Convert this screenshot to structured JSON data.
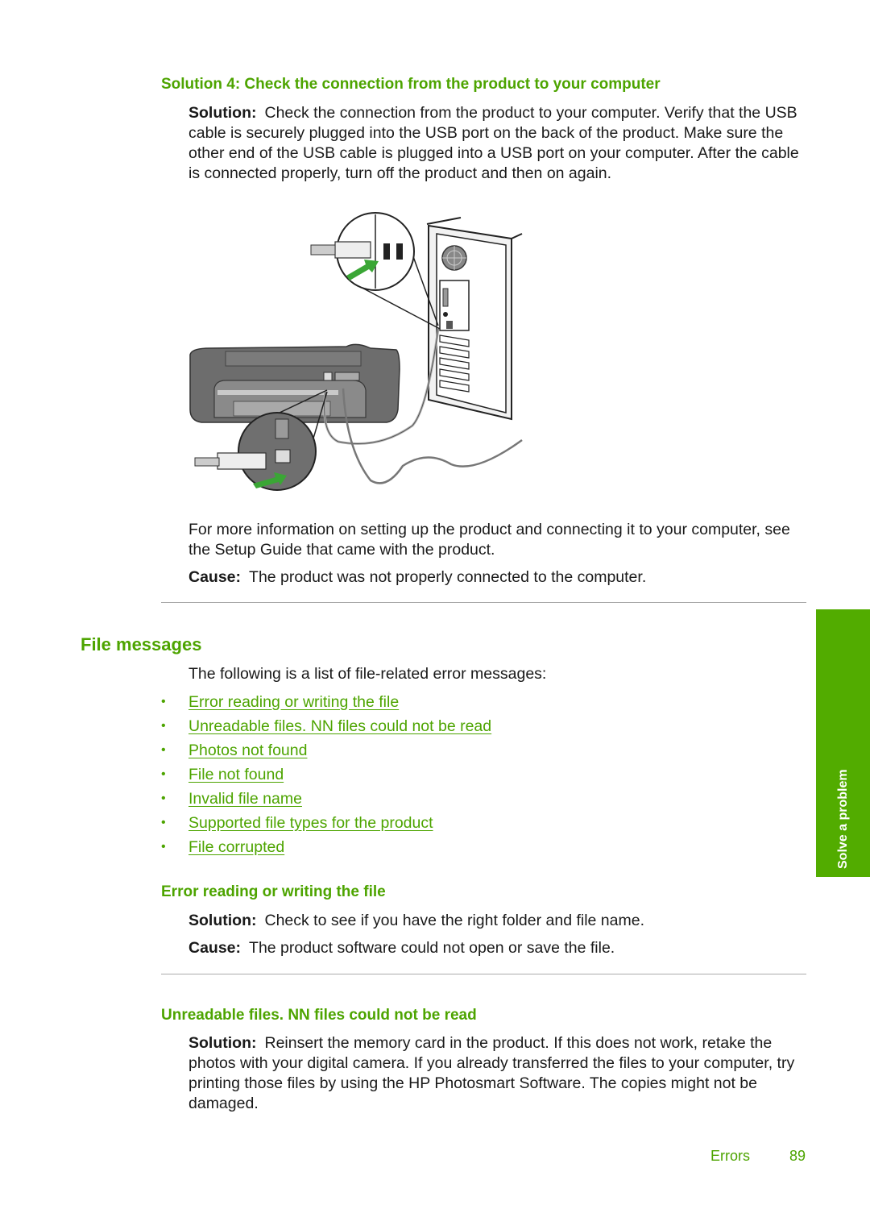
{
  "section_solution4": {
    "heading": "Solution 4: Check the connection from the product to your computer",
    "solution_label": "Solution:",
    "solution_text": "Check the connection from the product to your computer. Verify that the USB cable is securely plugged into the USB port on the back of the product. Make sure the other end of the USB cable is plugged into a USB port on your computer. After the cable is connected properly, turn off the product and then on again.",
    "illustration": "USB cable connecting printer rear port to computer USB port",
    "more_info_text": "For more information on setting up the product and connecting it to your computer, see the Setup Guide that came with the product.",
    "cause_label": "Cause:",
    "cause_text": "The product was not properly connected to the computer."
  },
  "file_messages": {
    "heading": "File messages",
    "intro": "The following is a list of file-related error messages:",
    "bullet": "•",
    "links": [
      "Error reading or writing the file",
      "Unreadable files. NN files could not be read",
      "Photos not found",
      "File not found",
      "Invalid file name",
      "Supported file types for the product",
      "File corrupted"
    ]
  },
  "error_reading": {
    "heading": "Error reading or writing the file",
    "solution_label": "Solution:",
    "solution_text": "Check to see if you have the right folder and file name.",
    "cause_label": "Cause:",
    "cause_text": "The product software could not open or save the file."
  },
  "unreadable_files": {
    "heading": "Unreadable files. NN files could not be read",
    "solution_label": "Solution:",
    "solution_text": "Reinsert the memory card in the product. If this does not work, retake the photos with your digital camera. If you already transferred the files to your computer, try printing those files by using the HP Photosmart Software. The copies might not be damaged."
  },
  "side_tab": {
    "label": "Solve a problem"
  },
  "footer": {
    "section": "Errors",
    "page_number": "89"
  },
  "colors": {
    "accent": "#4da400",
    "tab": "#52ac00",
    "rule": "#aaaaaa"
  }
}
